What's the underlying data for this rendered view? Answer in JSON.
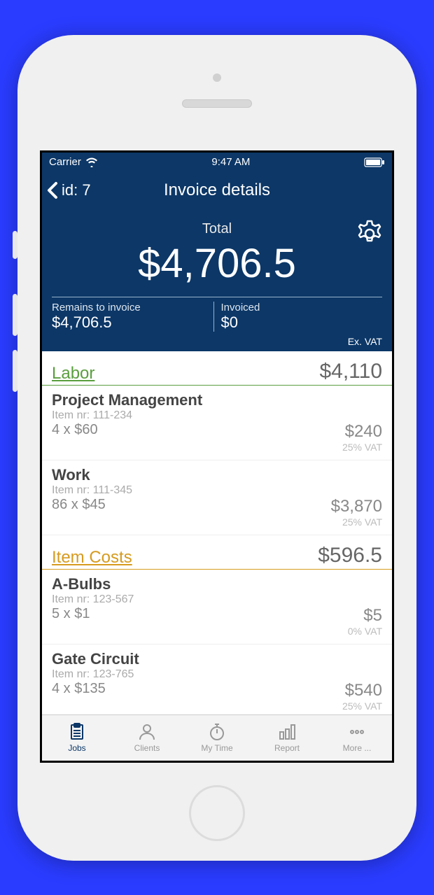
{
  "statusBar": {
    "carrier": "Carrier",
    "time": "9:47 AM"
  },
  "nav": {
    "back": "id: 7",
    "title": "Invoice details"
  },
  "summary": {
    "totalLabel": "Total",
    "totalAmount": "$4,706.5",
    "remainsLabel": "Remains to invoice",
    "remainsAmount": "$4,706.5",
    "invoicedLabel": "Invoiced",
    "invoicedAmount": "$0",
    "exVat": "Ex. VAT"
  },
  "sections": {
    "labor": {
      "name": "Labor",
      "amount": "$4,110"
    },
    "itemCosts": {
      "name": "Item Costs",
      "amount": "$596.5"
    }
  },
  "items": {
    "pm": {
      "title": "Project Management",
      "itemNr": "Item nr: 111-234",
      "qty": "4 x $60",
      "price": "$240",
      "vat": "25% VAT"
    },
    "work": {
      "title": "Work",
      "itemNr": "Item nr: 111-345",
      "qty": "86 x $45",
      "price": "$3,870",
      "vat": "25% VAT"
    },
    "bulbs": {
      "title": "A-Bulbs",
      "itemNr": "Item nr: 123-567",
      "qty": "5 x $1",
      "price": "$5",
      "vat": "0% VAT"
    },
    "gate": {
      "title": "Gate Circuit",
      "itemNr": "Item nr: 123-765",
      "qty": "4 x $135",
      "price": "$540",
      "vat": "25% VAT"
    }
  },
  "tabs": {
    "jobs": "Jobs",
    "clients": "Clients",
    "mytime": "My Time",
    "report": "Report",
    "more": "More ..."
  }
}
